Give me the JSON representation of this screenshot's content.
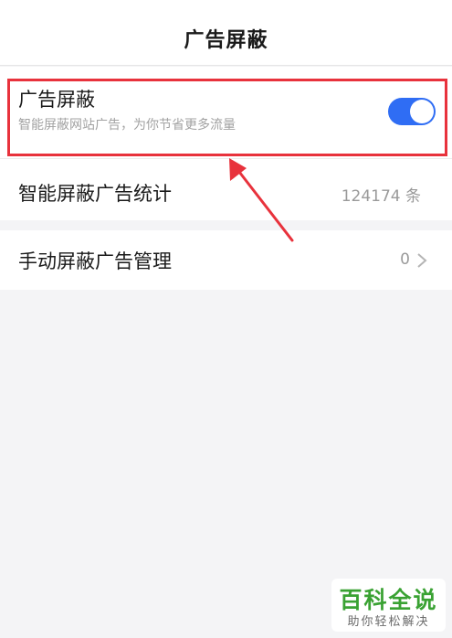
{
  "header": {
    "title": "广告屏蔽"
  },
  "adblock": {
    "title": "广告屏蔽",
    "subtitle": "智能屏蔽网站广告，为你节省更多流量",
    "toggle_on": 1,
    "toggle_color": "#2f6df4"
  },
  "stats": {
    "label": "智能屏蔽广告统计",
    "value": "124174 条"
  },
  "manual": {
    "label": "手动屏蔽广告管理",
    "value": "0"
  },
  "icons": {
    "chevron": "chevron-right-icon",
    "arrow": "red-arrow-annotation"
  },
  "colors": {
    "highlight": "#e8323c",
    "accent": "#2f6df4"
  },
  "watermark": {
    "title": "百科全说",
    "subtitle": "助你轻松解决"
  }
}
